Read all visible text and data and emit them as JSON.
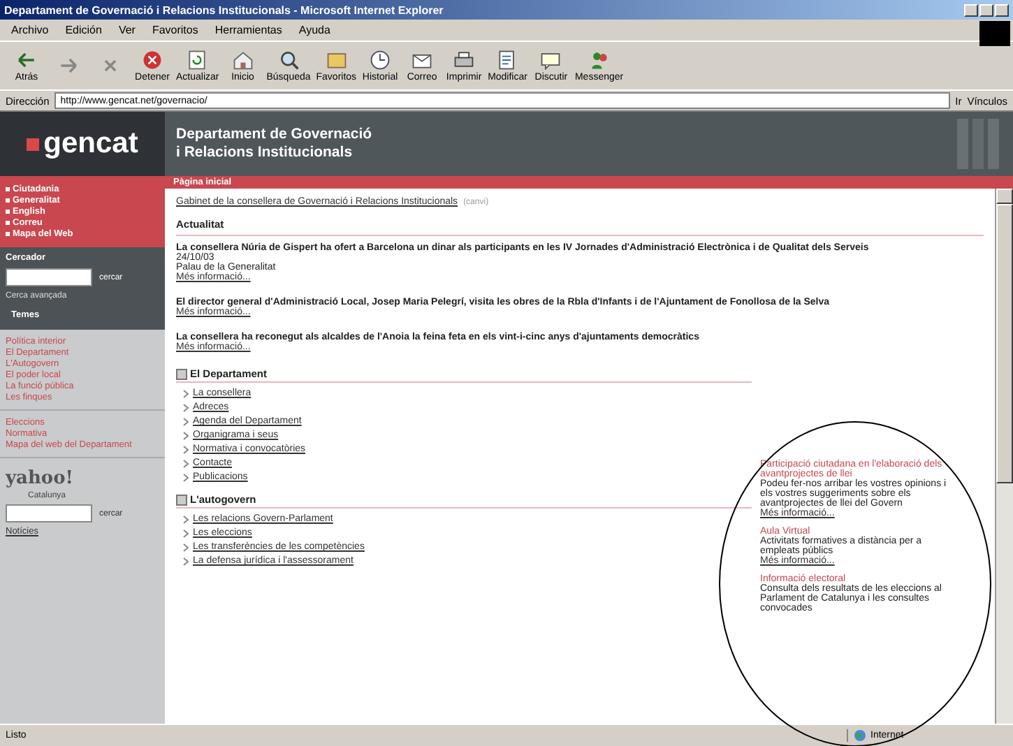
{
  "window": {
    "title": "Departament de Governació i Relacions Institucionals - Microsoft Internet Explorer"
  },
  "menu": [
    "Archivo",
    "Edición",
    "Ver",
    "Favoritos",
    "Herramientas",
    "Ayuda"
  ],
  "toolbar": [
    {
      "label": "Atrás",
      "kind": "back"
    },
    {
      "kind": "forward"
    },
    {
      "kind": "stop-x"
    },
    {
      "label": "Detener",
      "kind": "stop"
    },
    {
      "label": "Actualizar",
      "kind": "refresh"
    },
    {
      "label": "Inicio",
      "kind": "home"
    },
    {
      "label": "Búsqueda",
      "kind": "search"
    },
    {
      "label": "Favoritos",
      "kind": "favorites"
    },
    {
      "label": "Historial",
      "kind": "history"
    },
    {
      "label": "Correo",
      "kind": "mail"
    },
    {
      "label": "Imprimir",
      "kind": "print"
    },
    {
      "label": "Modificar",
      "kind": "edit"
    },
    {
      "label": "Discutir",
      "kind": "discuss"
    },
    {
      "label": "Messenger",
      "kind": "messenger"
    }
  ],
  "address": {
    "label": "Dirección",
    "value": "http://www.gencat.net/governacio/",
    "go": "Ir",
    "links": "Vínculos"
  },
  "site": {
    "logo": "gencat",
    "title_1": "Departament de Governació",
    "title_2": "i Relacions Institucionals",
    "bar": "Pàgina inicial"
  },
  "sidebar": {
    "links": [
      "Ciutadania",
      "Generalitat",
      "English",
      "Correu",
      "Mapa del Web"
    ],
    "search": {
      "heading": "Cercador",
      "button": "cercar",
      "advanced": "Cerca avançada"
    },
    "tab": "Temes",
    "topics": [
      "Política interior",
      "El Departament",
      "L'Autogovern",
      "El poder local",
      "La funció pública",
      "Les finques"
    ],
    "more": [
      "Eleccions",
      "Normativa",
      "Mapa del web del Departament"
    ],
    "yahoo": {
      "logo": "yahoo!",
      "sub": "Catalunya",
      "button": "cercar",
      "link": "Notícies"
    }
  },
  "breadcrumb": {
    "link": "Gabinet de la consellera de Governació i Relacions Institucionals",
    "note": "(canvi)"
  },
  "news": {
    "heading": "Actualitat",
    "items": [
      {
        "title": "La consellera Núria de Gispert ha ofert a Barcelona un dinar als participants en les IV Jornades d'Administració Electrònica i de Qualitat dels Serveis",
        "date": "24/10/03",
        "place": "Palau de la Generalitat",
        "more": "Més informació..."
      },
      {
        "title": "El director general d'Administració Local, Josep Maria Pelegrí, visita les obres de la Rbla d'Infants i de l'Ajuntament de Fonollosa de la Selva",
        "more": "Més informació..."
      },
      {
        "title": "La consellera ha reconegut als alcaldes de l'Anoia la feina feta en els vint-i-cinc anys d'ajuntaments democràtics",
        "more": "Més informació..."
      }
    ]
  },
  "sections": [
    {
      "title": "El Departament",
      "links": [
        "La consellera",
        "Adreces",
        "Agenda del Departament",
        "Organigrama i seus",
        "Normativa i convocatòries",
        "Contacte",
        "Publicacions"
      ]
    },
    {
      "title": "L'autogovern",
      "links": [
        "Les relacions Govern-Parlament",
        "Les eleccions",
        "Les transferències de les competències",
        "La defensa jurídica i l'assessorament"
      ]
    }
  ],
  "promos": [
    {
      "title": "Participació ciutadana en l'elaboració dels avantprojectes de llei",
      "text": "Podeu fer-nos arribar les vostres opinions i els vostres suggeriments sobre els avantprojectes de llei del Govern",
      "more": "Més informació..."
    },
    {
      "title": "Aula Virtual",
      "text": "Activitats formatives a distància per a empleats públics",
      "more": "Més informació..."
    },
    {
      "title": "Informació electoral",
      "text": "Consulta dels resultats de les eleccions al Parlament de Catalunya i les consultes convocades"
    }
  ],
  "status_bar": {
    "text": "Listo",
    "zone": "Internet"
  }
}
